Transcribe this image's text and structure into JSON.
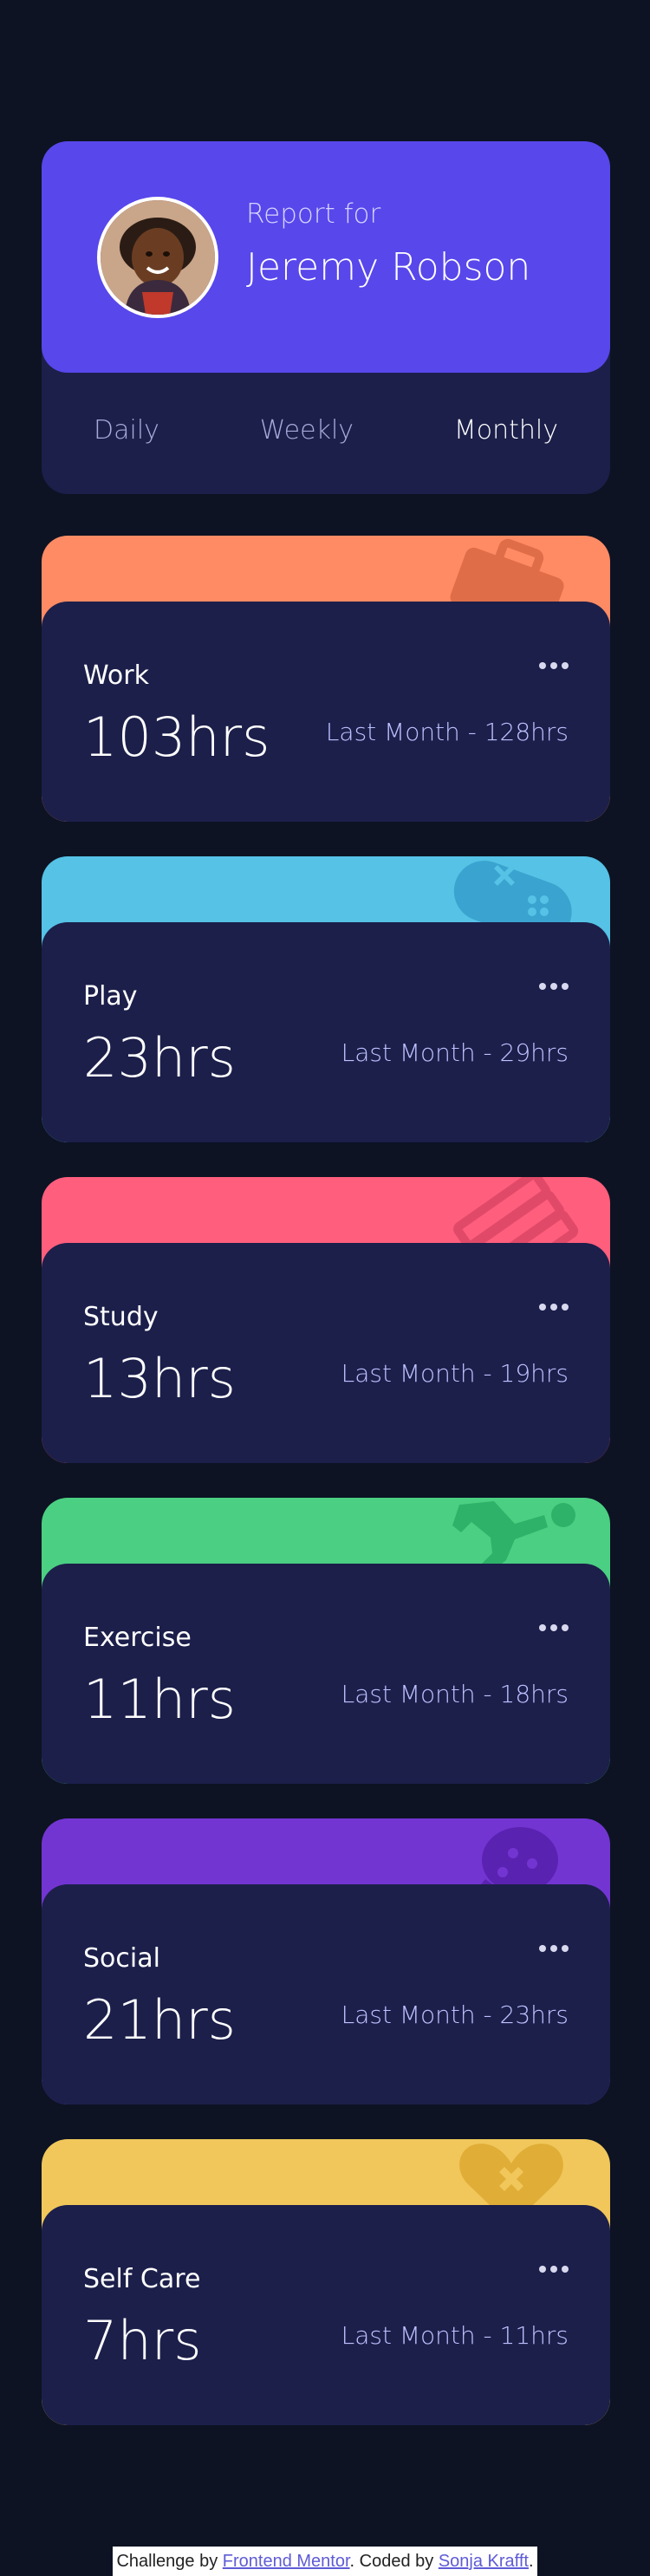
{
  "profile": {
    "label": "Report for",
    "name": "Jeremy Robson",
    "avatar_icon": "user-avatar-photo"
  },
  "periods": [
    {
      "label": "Daily",
      "active": false
    },
    {
      "label": "Weekly",
      "active": false
    },
    {
      "label": "Monthly",
      "active": true
    }
  ],
  "activities": [
    {
      "title": "Work",
      "current": "103hrs",
      "previous": "Last Month - 128hrs",
      "color": "#ff8b64",
      "icon": "briefcase-icon"
    },
    {
      "title": "Play",
      "current": "23hrs",
      "previous": "Last Month - 29hrs",
      "color": "#55c2e6",
      "icon": "gamepad-icon"
    },
    {
      "title": "Study",
      "current": "13hrs",
      "previous": "Last Month - 19hrs",
      "color": "#ff5e7d",
      "icon": "books-icon"
    },
    {
      "title": "Exercise",
      "current": "11hrs",
      "previous": "Last Month - 18hrs",
      "color": "#4bcf82",
      "icon": "running-icon"
    },
    {
      "title": "Social",
      "current": "21hrs",
      "previous": "Last Month - 23hrs",
      "color": "#7335d2",
      "icon": "speech-bubble-icon"
    },
    {
      "title": "Self Care",
      "current": "7hrs",
      "previous": "Last Month - 11hrs",
      "color": "#f1c75b",
      "icon": "heart-icon"
    }
  ],
  "footer": {
    "prefix": "Challenge by ",
    "link1": "Frontend Mentor",
    "middle": ". Coded by ",
    "link2": "Sonja Krafft",
    "suffix": "."
  }
}
